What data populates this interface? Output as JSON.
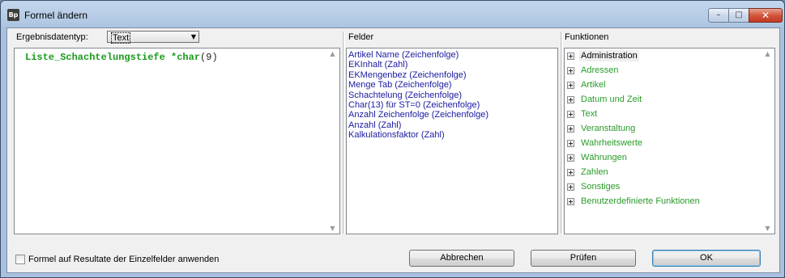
{
  "window": {
    "title": "Formel ändern",
    "app_icon_text": "Bp",
    "controls": {
      "minimize": "–",
      "maximize": "□",
      "close": "✕"
    }
  },
  "result_type": {
    "label": "Ergebnisdatentyp:",
    "value": "Text",
    "arrow": "▼"
  },
  "editor": {
    "tokens": [
      {
        "text": "Liste_Schachtelungstiefe",
        "cls": "g"
      },
      {
        "text": " *",
        "cls": "g"
      },
      {
        "text": "char",
        "cls": "g"
      },
      {
        "text": "(9)",
        "cls": "n"
      }
    ]
  },
  "fields": {
    "header": "Felder",
    "items": [
      "Artikel Name (Zeichenfolge)",
      "EKInhalt (Zahl)",
      "EKMengenbez (Zeichenfolge)",
      "Menge Tab (Zeichenfolge)",
      "Schachtelung (Zeichenfolge)",
      "Char(13) für ST=0 (Zeichenfolge)",
      "Anzahl Zeichenfolge (Zeichenfolge)",
      "Anzahl (Zahl)",
      "Kalkulationsfaktor (Zahl)"
    ]
  },
  "functions": {
    "header": "Funktionen",
    "items": [
      {
        "label": "Administration",
        "selected": true
      },
      {
        "label": "Adressen",
        "selected": false
      },
      {
        "label": "Artikel",
        "selected": false
      },
      {
        "label": "Datum und Zeit",
        "selected": false
      },
      {
        "label": "Text",
        "selected": false
      },
      {
        "label": "Veranstaltung",
        "selected": false
      },
      {
        "label": "Wahrheitswerte",
        "selected": false
      },
      {
        "label": "Währungen",
        "selected": false
      },
      {
        "label": "Zahlen",
        "selected": false
      },
      {
        "label": "Sonstiges",
        "selected": false
      },
      {
        "label": "Benutzerdefinierte Funktionen",
        "selected": false
      }
    ]
  },
  "apply_checkbox": {
    "label": "Formel auf Resultate der Einzelfelder anwenden",
    "checked": false
  },
  "buttons": {
    "cancel": "Abbrechen",
    "check": "Prüfen",
    "ok": "OK"
  },
  "scroll": {
    "up": "▲",
    "down": "▼"
  }
}
